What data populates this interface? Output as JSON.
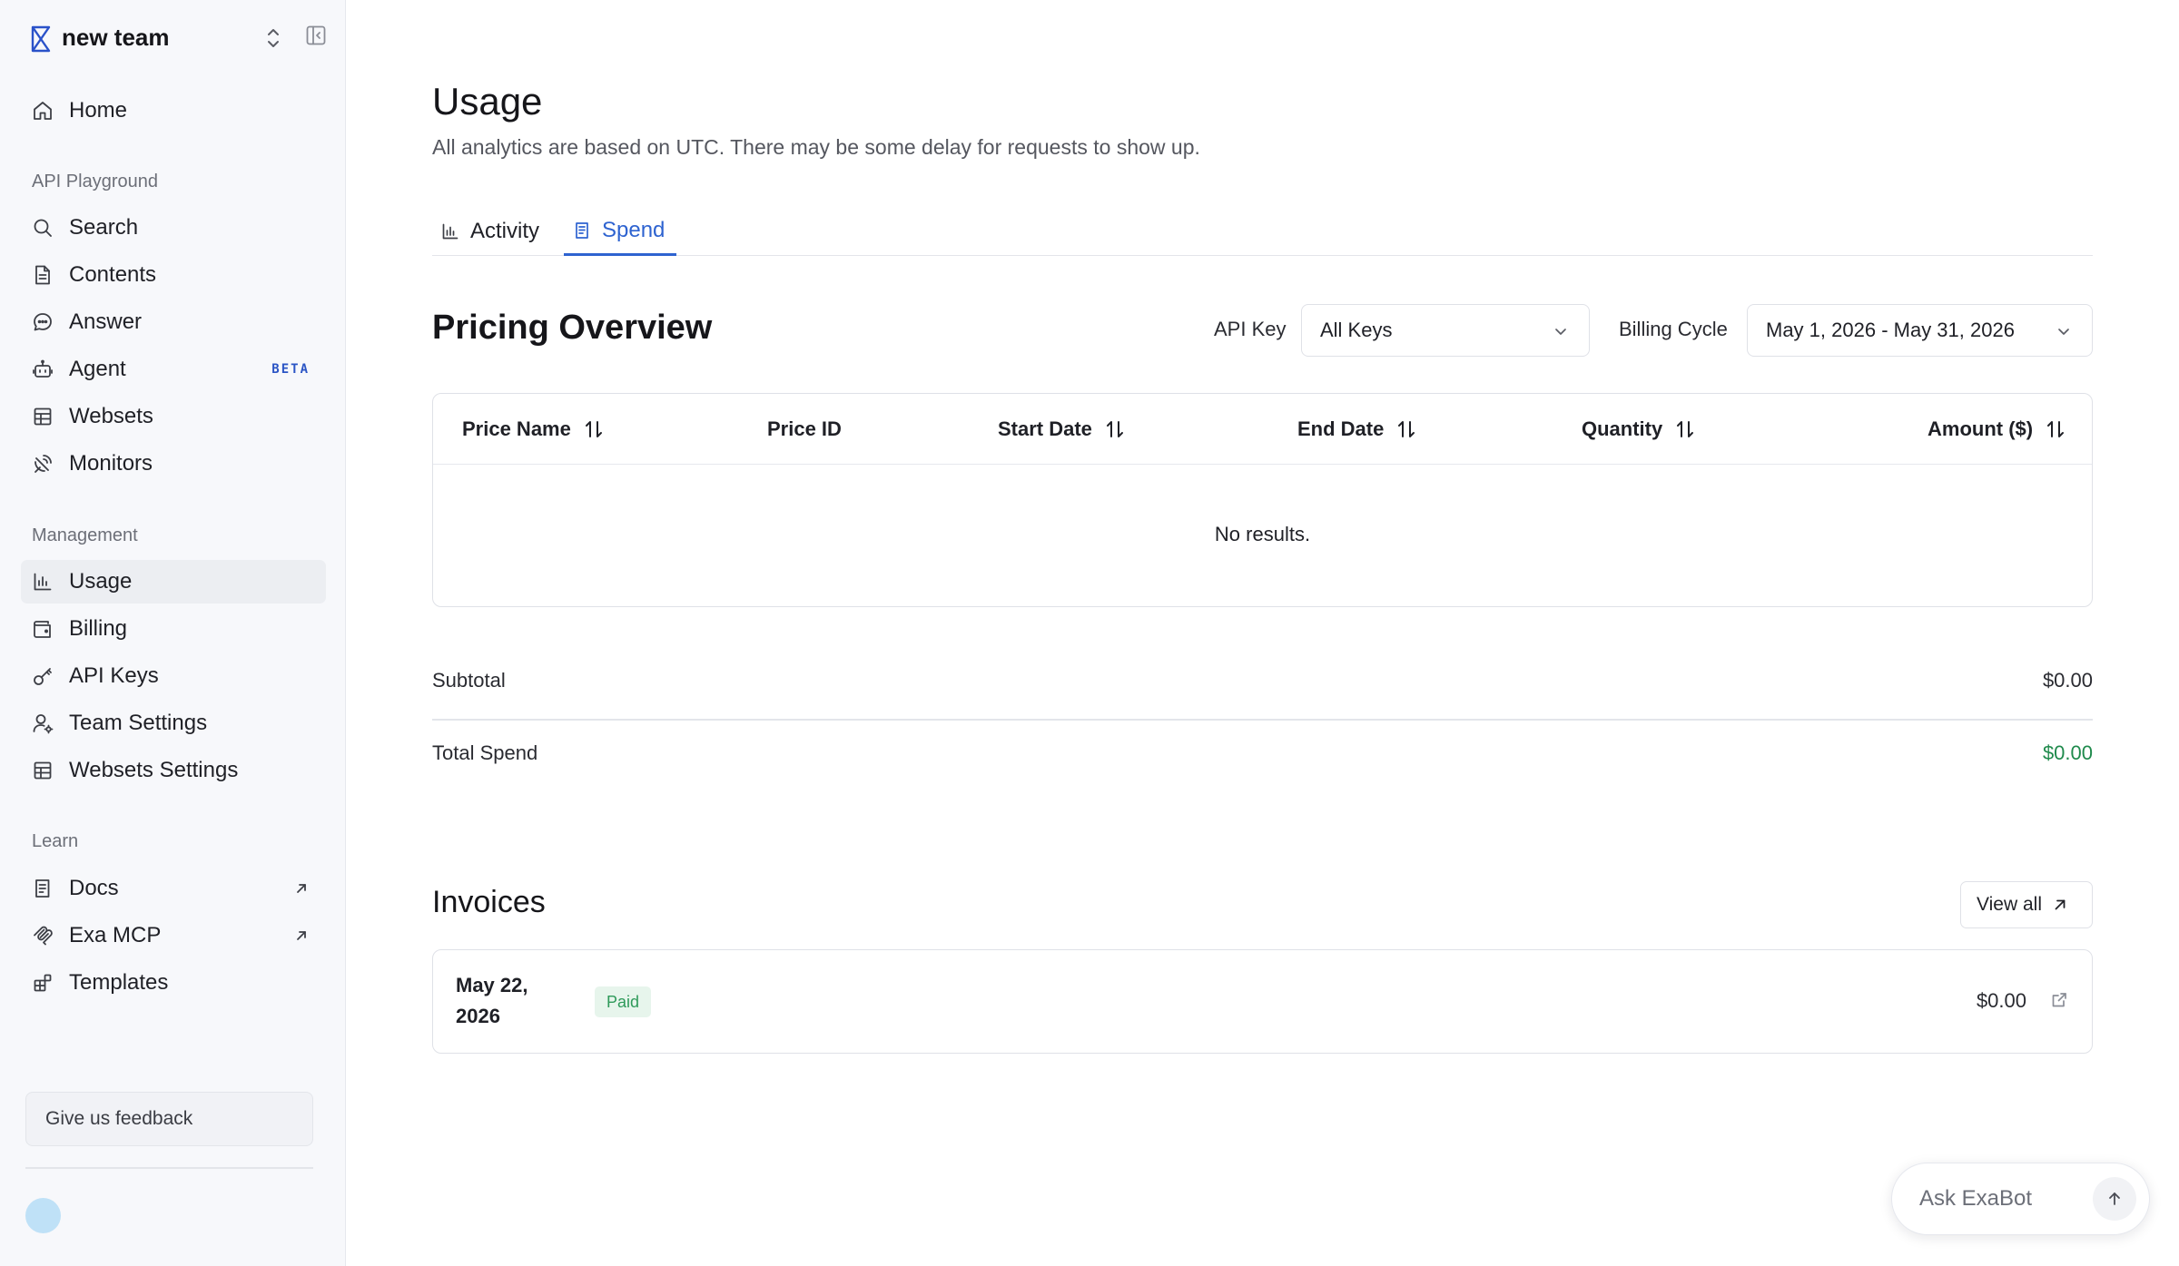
{
  "sidebar": {
    "team_name": "new team",
    "home": "Home",
    "sections": {
      "api_playground": "API Playground",
      "management": "Management",
      "learn": "Learn"
    },
    "playground_items": [
      "Search",
      "Contents",
      "Answer",
      "Agent",
      "Websets",
      "Monitors"
    ],
    "agent_badge": "BETA",
    "management_items": [
      "Usage",
      "Billing",
      "API Keys",
      "Team Settings",
      "Websets Settings"
    ],
    "learn_items": [
      "Docs",
      "Exa MCP",
      "Templates"
    ],
    "active_item": "Usage",
    "feedback_label": "Give us feedback"
  },
  "header": {
    "title": "Usage",
    "subtitle": "All analytics are based on UTC. There may be some delay for requests to show up."
  },
  "tabs": [
    {
      "label": "Activity",
      "active": false
    },
    {
      "label": "Spend",
      "active": true
    }
  ],
  "pricing": {
    "title": "Pricing Overview",
    "api_key_label": "API Key",
    "api_key_value": "All Keys",
    "billing_cycle_label": "Billing Cycle",
    "billing_cycle_value": "May 1, 2026 - May 31, 2026",
    "columns": [
      "Price Name",
      "Price ID",
      "Start Date",
      "End Date",
      "Quantity",
      "Amount ($)"
    ],
    "empty_text": "No results.",
    "subtotal_label": "Subtotal",
    "subtotal_value": "$0.00",
    "total_label": "Total Spend",
    "total_value": "$0.00"
  },
  "invoices": {
    "title": "Invoices",
    "view_all_label": "View all",
    "items": [
      {
        "date": "May 22, 2026",
        "status": "Paid",
        "amount": "$0.00"
      }
    ]
  },
  "exabot": {
    "placeholder": "Ask ExaBot"
  },
  "colors": {
    "accent": "#2e63d0",
    "total_green": "#1f8a4c",
    "paid_badge_bg": "#e7f5ec",
    "paid_badge_text": "#2f9a5a",
    "sidebar_bg": "#f7f8fb",
    "avatar": "#bfe1f7"
  }
}
